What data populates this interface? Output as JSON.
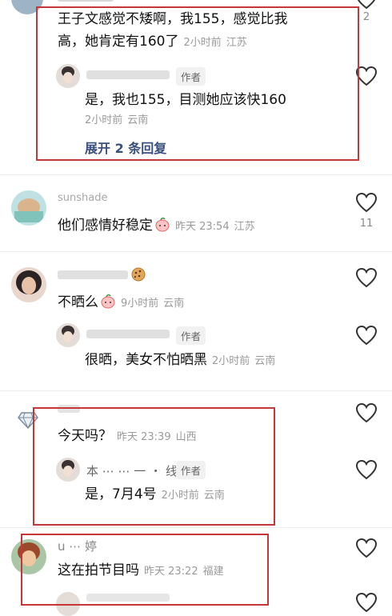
{
  "comments": [
    {
      "text_line1": "王子文感觉不矮啊，我155，感觉比我",
      "text_line2": "高，她肯定有160了",
      "time": "2小时前",
      "location": "江苏",
      "like_count": "2",
      "reply": {
        "author_tag": "作者",
        "text": "是，我也155，目测她应该快160",
        "time": "2小时前",
        "location": "云南"
      },
      "expand_label": "展开 2 条回复"
    },
    {
      "username": "sunshade",
      "text": "他们感情好稳定",
      "time": "昨天 23:54",
      "location": "江苏",
      "like_count": "11"
    },
    {
      "text": "不晒么",
      "time": "9小时前",
      "location": "云南",
      "reply": {
        "author_tag": "作者",
        "text": "很晒，美女不怕晒黑",
        "time": "2小时前",
        "location": "云南"
      }
    },
    {
      "text": "今天吗？",
      "time": "昨天 23:39",
      "location": "山西",
      "reply": {
        "author_name": "本 ⋯ ⋯ 一 ・ 线",
        "author_tag": "作者",
        "text": "是，7月4号",
        "time": "2小时前",
        "location": "云南"
      }
    },
    {
      "username": "u ⋯ 婷",
      "text": "这在拍节目吗",
      "time": "昨天 23:22",
      "location": "福建"
    }
  ],
  "colors": {
    "highlight_box": "#c7373a",
    "link": "#39507e",
    "meta": "#9a9a9a"
  },
  "icons": {
    "like": "heart-outline-icon",
    "emoji_a": "peach-emoji-icon",
    "emoji_b": "cookie-emoji-icon",
    "emoji_c": "diamond-icon"
  }
}
